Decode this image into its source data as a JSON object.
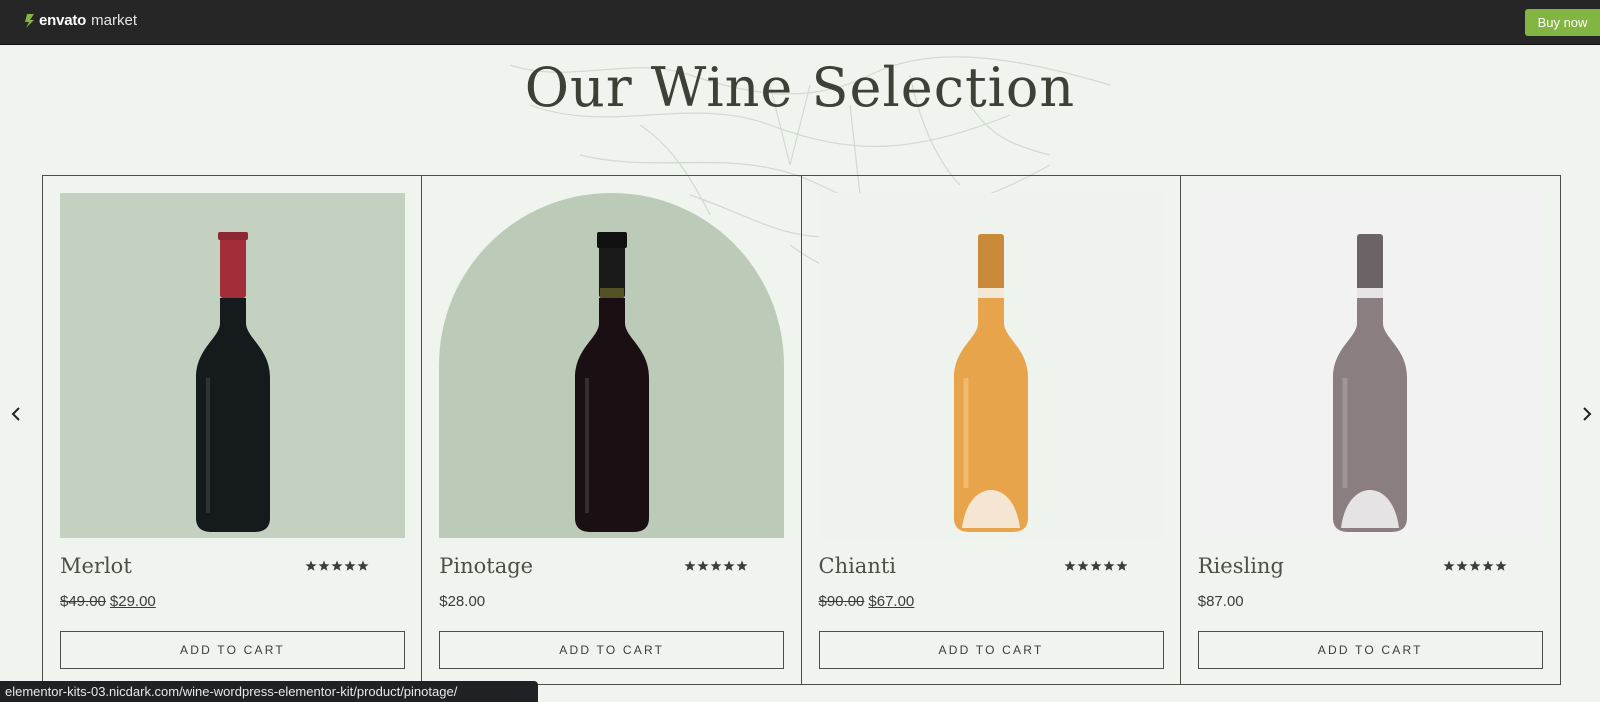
{
  "topbar": {
    "logo_brand": "envato",
    "logo_suffix": "market",
    "logo_icon": "envato-leaf-icon",
    "buy_label": "Buy now",
    "accent": "#82b541"
  },
  "section": {
    "title": "Our Wine Selection"
  },
  "carousel": {
    "prev_icon": "chevron-left-icon",
    "next_icon": "chevron-right-icon"
  },
  "products": [
    {
      "name": "Merlot",
      "old_price": "$49.00",
      "price": "$29.00",
      "rating": 5,
      "cart_label": "ADD TO CART",
      "bottle_color": "#151a1c",
      "cap_color": "#a32e3a",
      "bg": "square-green"
    },
    {
      "name": "Pinotage",
      "old_price": "",
      "price": "$28.00",
      "rating": 5,
      "cart_label": "ADD TO CART",
      "bottle_color": "#1a1014",
      "cap_color": "#1a1a1a",
      "bg": "arch-green"
    },
    {
      "name": "Chianti",
      "old_price": "$90.00",
      "price": "$67.00",
      "rating": 5,
      "cart_label": "ADD TO CART",
      "bottle_color": "#e8a44a",
      "cap_color": "#c98a3a",
      "bg": "plain"
    },
    {
      "name": "Riesling",
      "old_price": "",
      "price": "$87.00",
      "rating": 5,
      "cart_label": "ADD TO CART",
      "bottle_color": "#8a7e80",
      "cap_color": "#6b6366",
      "bg": "plain-grey"
    }
  ],
  "status": {
    "url": "elementor-kits-03.nicdark.com/wine-wordpress-elementor-kit/product/pinotage/"
  }
}
